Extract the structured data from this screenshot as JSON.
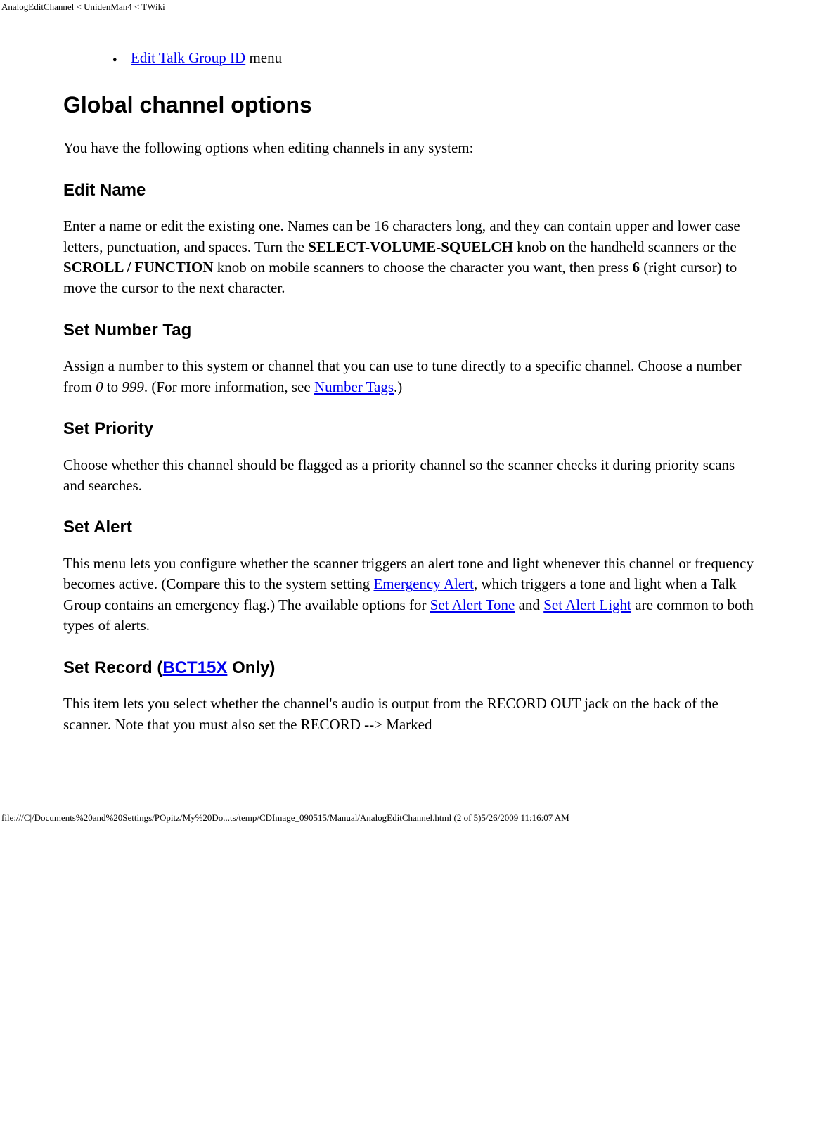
{
  "header": {
    "breadcrumb": "AnalogEditChannel < UnidenMan4 < TWiki"
  },
  "topList": {
    "linkText": "Edit Talk Group ID",
    "suffix": " menu"
  },
  "h1": "Global channel options",
  "intro": "You have the following options when editing channels in any system:",
  "editName": {
    "heading": "Edit Name",
    "p1a": "Enter a name or edit the existing one. Names can be 16 characters long, and they can contain upper and lower case letters, punctuation, and spaces. Turn the ",
    "bold1": "SELECT-VOLUME-SQUELCH",
    "p1b": " knob on the handheld scanners or the ",
    "bold2": "SCROLL / FUNCTION",
    "p1c": " knob on mobile scanners to choose the character you want, then press ",
    "bold3": "6",
    "p1d": " (right cursor) to move the cursor to the next character."
  },
  "setNumberTag": {
    "heading": "Set Number Tag",
    "p1a": "Assign a number to this system or channel that you can use to tune directly to a specific channel. Choose a number from ",
    "it1": "0",
    "p1b": " to ",
    "it2": "999",
    "p1c": ". (For more information, see ",
    "link": "Number Tags",
    "p1d": ".)"
  },
  "setPriority": {
    "heading": "Set Priority",
    "p": "Choose whether this channel should be flagged as a priority channel so the scanner checks it during priority scans and searches."
  },
  "setAlert": {
    "heading": "Set Alert",
    "p1a": "This menu lets you configure whether the scanner triggers an alert tone and light whenever this channel or frequency becomes active. (Compare this to the system setting ",
    "link1": "Emergency Alert",
    "p1b": ", which triggers a tone and light when a Talk Group contains an emergency flag.) The available options for ",
    "link2": "Set Alert Tone",
    "p1c": " and ",
    "link3": "Set Alert Light",
    "p1d": " are common to both types of alerts."
  },
  "setRecord": {
    "headingPre": "Set Record (",
    "headingLink": "BCT15X",
    "headingPost": " Only)",
    "p": "This item lets you select whether the channel's audio is output from the RECORD OUT jack on the back of the scanner. Note that you must also set the RECORD --> Marked"
  },
  "footer": "file:///C|/Documents%20and%20Settings/POpitz/My%20Do...ts/temp/CDImage_090515/Manual/AnalogEditChannel.html (2 of 5)5/26/2009 11:16:07 AM"
}
